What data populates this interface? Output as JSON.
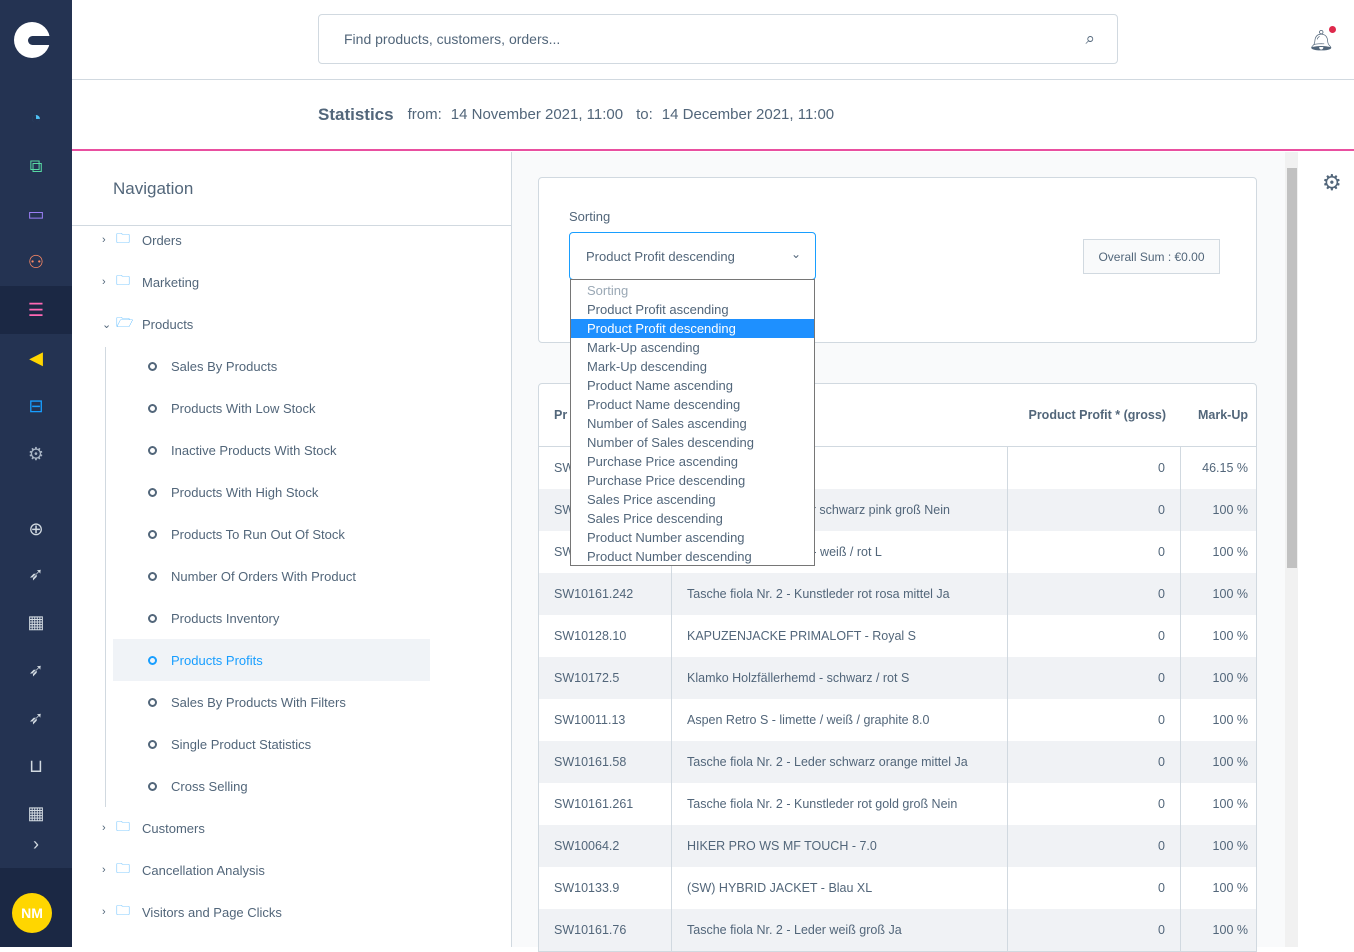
{
  "sidebar": {
    "avatar_initials": "NM",
    "icons": [
      "dashboard-icon",
      "catalogues-icon",
      "orders-icon",
      "customers-icon",
      "content-icon",
      "marketing-icon",
      "extensions-icon",
      "settings-icon",
      "add-icon",
      "rocket-icon",
      "storefront-icon",
      "rocket-icon",
      "rocket-icon",
      "basket-icon",
      "storefront-icon",
      "expand-icon"
    ],
    "colors": {
      "background": "#243352",
      "dashboard": "#57d9a3",
      "marketing": "#ffd600",
      "content": "#ff68b4"
    }
  },
  "header": {
    "search_placeholder": "Find products, customers, orders..."
  },
  "stats": {
    "title": "Statistics",
    "from_label": "from:",
    "from": "14 November 2021, 11:00",
    "to_label": "to:",
    "to": "14 December 2021, 11:00"
  },
  "navigation": {
    "title": "Navigation",
    "orders": "Orders",
    "marketing": "Marketing",
    "products": "Products",
    "product_items": [
      "Sales By Products",
      "Products With Low Stock",
      "Inactive Products With Stock",
      "Products With High Stock",
      "Products To Run Out Of Stock",
      "Number Of Orders With Product",
      "Products Inventory",
      "Products Profits",
      "Sales By Products With Filters",
      "Single Product Statistics",
      "Cross Selling"
    ],
    "active_item": "Products Profits",
    "customers": "Customers",
    "cancellation": "Cancellation Analysis",
    "visitors": "Visitors and Page Clicks"
  },
  "filters": {
    "sorting_label": "Sorting",
    "sorting_value": "Product Profit descending",
    "overall_sum": "Overall Sum : €0.00",
    "options": [
      "Sorting",
      "Product Profit ascending",
      "Product Profit descending",
      "Mark-Up ascending",
      "Mark-Up descending",
      "Product Name ascending",
      "Product Name descending",
      "Number of Sales ascending",
      "Number of Sales descending",
      "Purchase Price ascending",
      "Purchase Price descending",
      "Sales Price ascending",
      "Sales Price descending",
      "Product Number ascending",
      "Product Number descending"
    ]
  },
  "table": {
    "headers": {
      "number": "Pr",
      "name": "",
      "profit": "Product Profit * (gross)",
      "markup": "Mark-Up"
    },
    "rows": [
      {
        "number": "SW",
        "name": "",
        "profit": "0",
        "markup": "46.15 %"
      },
      {
        "number": "SW",
        "name": "ler schwarz pink groß Nein",
        "profit": "0",
        "markup": "100 %"
      },
      {
        "number": "SW",
        "name": "d - weiß / rot L",
        "profit": "0",
        "markup": "100 %"
      },
      {
        "number": "SW10161.242",
        "name": "Tasche fiola Nr. 2 - Kunstleder rot rosa mittel Ja",
        "profit": "0",
        "markup": "100 %"
      },
      {
        "number": "SW10128.10",
        "name": "KAPUZENJACKE PRIMALOFT - Royal S",
        "profit": "0",
        "markup": "100 %"
      },
      {
        "number": "SW10172.5",
        "name": "Klamko Holzfällerhemd - schwarz / rot S",
        "profit": "0",
        "markup": "100 %"
      },
      {
        "number": "SW10011.13",
        "name": "Aspen Retro S - limette / weiß / graphite 8.0",
        "profit": "0",
        "markup": "100 %"
      },
      {
        "number": "SW10161.58",
        "name": "Tasche fiola Nr. 2 - Leder schwarz orange mittel Ja",
        "profit": "0",
        "markup": "100 %"
      },
      {
        "number": "SW10161.261",
        "name": "Tasche fiola Nr. 2 - Kunstleder rot gold groß Nein",
        "profit": "0",
        "markup": "100 %"
      },
      {
        "number": "SW10064.2",
        "name": "HIKER PRO WS MF TOUCH - 7.0",
        "profit": "0",
        "markup": "100 %"
      },
      {
        "number": "SW10133.9",
        "name": "(SW) HYBRID JACKET - Blau XL",
        "profit": "0",
        "markup": "100 %"
      },
      {
        "number": "SW10161.76",
        "name": "Tasche fiola Nr. 2 - Leder weiß groß Ja",
        "profit": "0",
        "markup": "100 %"
      }
    ]
  }
}
